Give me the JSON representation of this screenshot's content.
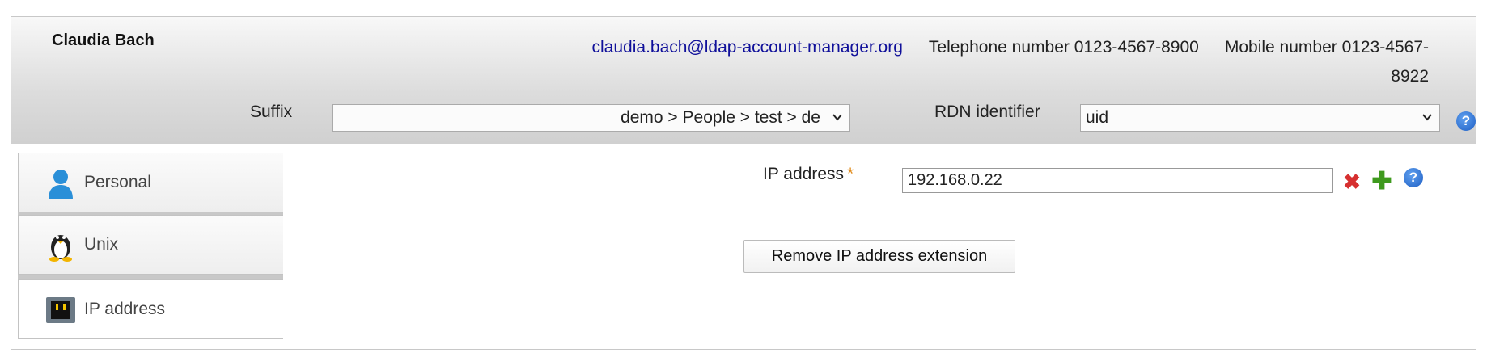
{
  "header": {
    "name": "Claudia Bach",
    "email": "claudia.bach@ldap-account-manager.org",
    "telephone": "Telephone number 0123-4567-8900",
    "mobile": "Mobile number 0123-4567-8922"
  },
  "dn": {
    "suffix_label": "Suffix",
    "suffix_value": "demo > People > test > de",
    "rdn_label": "RDN identifier",
    "rdn_value": "uid"
  },
  "tabs": [
    {
      "label": "Personal",
      "icon": "person-icon",
      "active": false
    },
    {
      "label": "Unix",
      "icon": "penguin-icon",
      "active": false
    },
    {
      "label": "IP address",
      "icon": "network-port-icon",
      "active": true
    }
  ],
  "main": {
    "ip_label": "IP address",
    "required_marker": "*",
    "ip_value": "192.168.0.22",
    "remove_button": "Remove IP address extension"
  },
  "icons": {
    "help": "?",
    "delete": "✖",
    "add": "✚",
    "chevron": "⌄"
  },
  "colors": {
    "link": "#10109a",
    "required": "#e08b1b",
    "help": "#1f5fc4",
    "delete": "#d63030",
    "add": "#3f9a1e"
  }
}
